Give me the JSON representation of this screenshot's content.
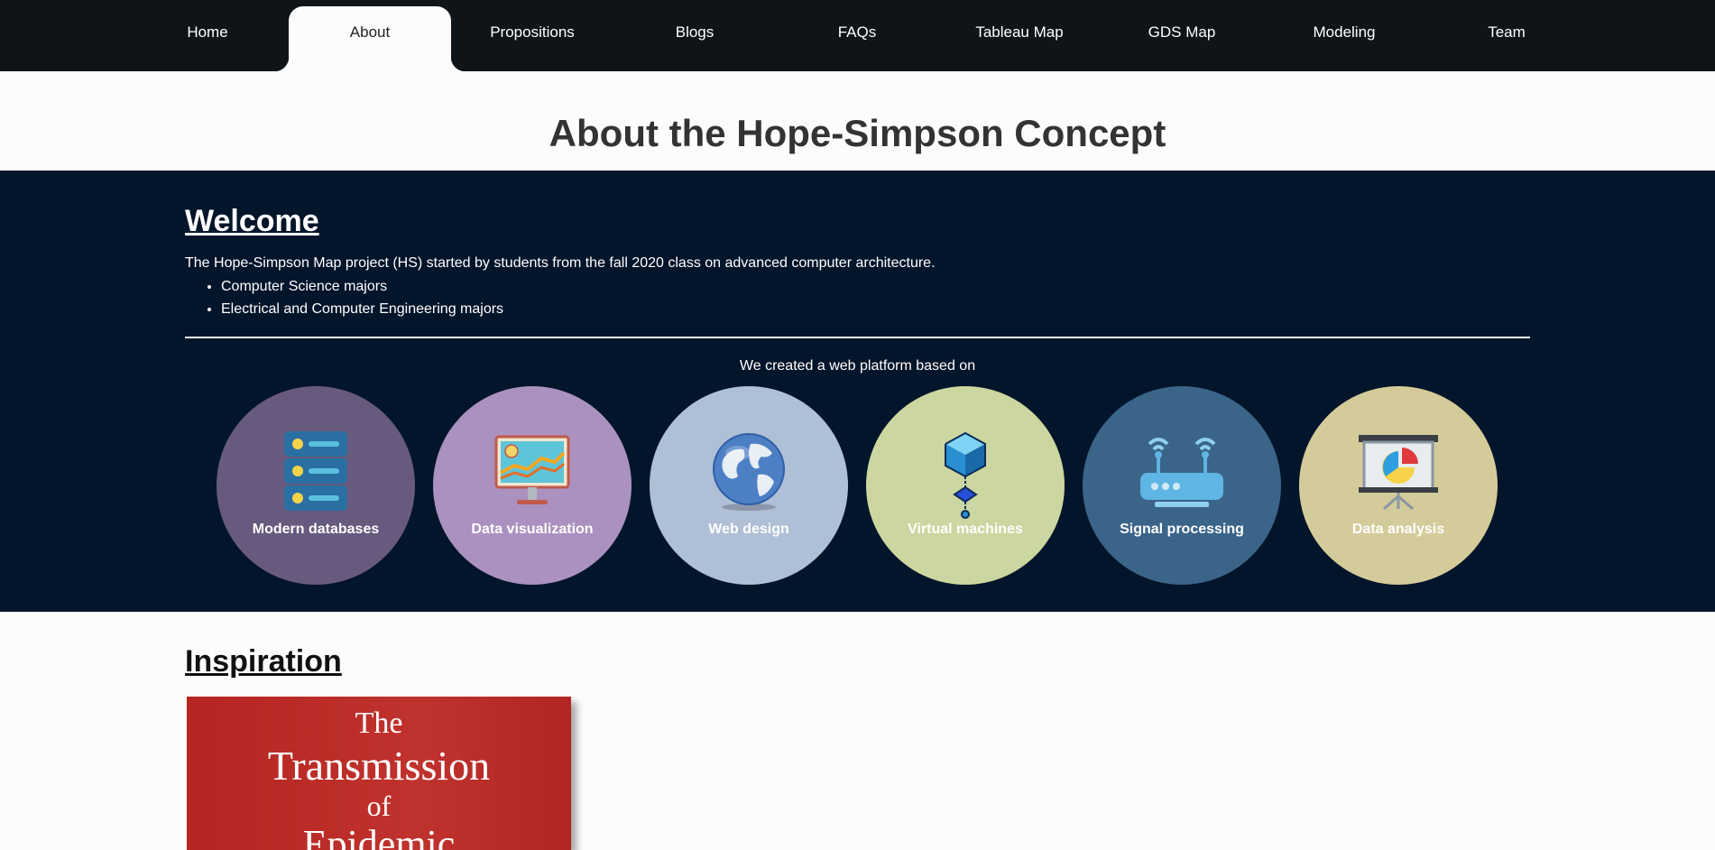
{
  "nav": {
    "items": [
      {
        "label": "Home"
      },
      {
        "label": "About",
        "active": true
      },
      {
        "label": "Propositions"
      },
      {
        "label": "Blogs"
      },
      {
        "label": "FAQs"
      },
      {
        "label": "Tableau Map"
      },
      {
        "label": "GDS Map"
      },
      {
        "label": "Modeling"
      },
      {
        "label": "Team"
      }
    ]
  },
  "page": {
    "title": "About the Hope-Simpson Concept"
  },
  "welcome": {
    "heading": "Welcome",
    "intro": "The Hope-Simpson Map project (HS) started by students from the fall 2020 class on advanced computer architecture.",
    "majors": [
      "Computer Science majors",
      "Electrical and Computer Engineering majors"
    ],
    "platform_text": "We created a web platform based on",
    "topics": [
      {
        "label": "Modern databases",
        "icon": "database-icon",
        "color": "#685a7e"
      },
      {
        "label": "Data visualization",
        "icon": "monitor-chart-icon",
        "color": "#ab91bf"
      },
      {
        "label": "Web design",
        "icon": "globe-icon",
        "color": "#afbfd5"
      },
      {
        "label": "Virtual machines",
        "icon": "cube-node-icon",
        "color": "#ccd6a0"
      },
      {
        "label": "Signal processing",
        "icon": "router-icon",
        "color": "#3a6488"
      },
      {
        "label": "Data analysis",
        "icon": "presentation-chart-icon",
        "color": "#d4cb9a"
      }
    ]
  },
  "inspiration": {
    "heading": "Inspiration",
    "book_lines": [
      "The",
      "Transmission",
      "of",
      "Epidemic"
    ]
  },
  "colors": {
    "nav_bg": "#0f1418",
    "band_bg": "#03152a",
    "book_red": "#b52521"
  }
}
